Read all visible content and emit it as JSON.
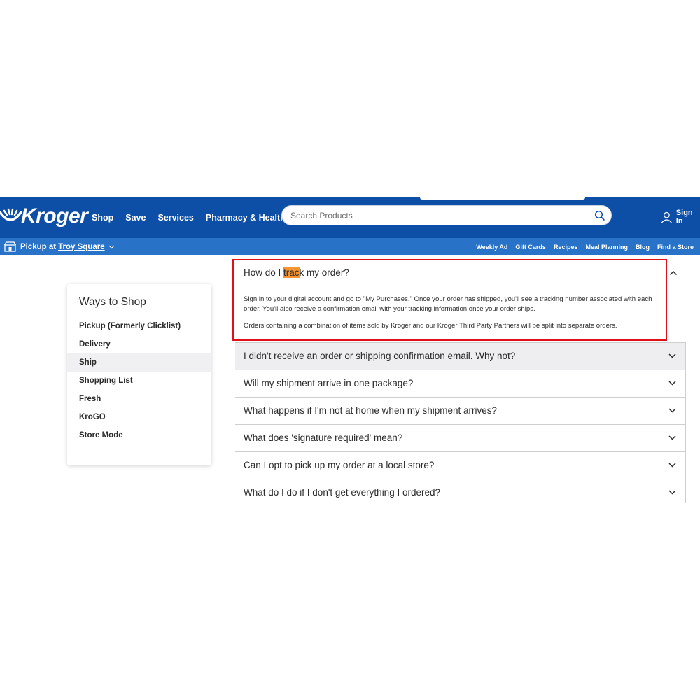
{
  "header": {
    "logo_text": "Kroger",
    "nav": [
      "Shop",
      "Save",
      "Services",
      "Pharmacy & Health"
    ],
    "search_placeholder": "Search Products",
    "sign_in": "Sign In",
    "brand_color": "#0d4ea6"
  },
  "subbar": {
    "pickup_prefix": "Pickup at",
    "pickup_store": "Troy Square",
    "links": [
      "Weekly Ad",
      "Gift Cards",
      "Recipes",
      "Meal Planning",
      "Blog",
      "Find a Store"
    ],
    "color": "#2872c8"
  },
  "sidebar": {
    "title": "Ways to Shop",
    "items": [
      {
        "label": "Pickup (Formerly Clicklist)",
        "active": false
      },
      {
        "label": "Delivery",
        "active": false
      },
      {
        "label": "Ship",
        "active": true
      },
      {
        "label": "Shopping List",
        "active": false
      },
      {
        "label": "Fresh",
        "active": false
      },
      {
        "label": "KroGO",
        "active": false
      },
      {
        "label": "Store Mode",
        "active": false
      }
    ]
  },
  "faq": {
    "open": {
      "q_before": "How do I ",
      "q_highlight": "trac",
      "q_after": "k my order?",
      "answer": [
        "Sign in to your digital account and go to \"My Purchases.\" Once your order has shipped, you'll see a tracking number associated with each order. You'll also receive a confirmation email with your tracking information once your order ships.",
        "Orders containing a combination of items sold by Kroger and our Kroger Third Party Partners will be split into separate orders."
      ],
      "highlight_color": "#f79430",
      "annotation_color": "#e0101a"
    },
    "items": [
      "I didn't receive an order or shipping confirmation email. Why not?",
      "Will my shipment arrive in one package?",
      "What happens if I'm not at home when my shipment arrives?",
      "What does 'signature required' mean?",
      "Can I opt to pick up my order at a local store?",
      "What do I do if I don't get everything I ordered?"
    ]
  }
}
